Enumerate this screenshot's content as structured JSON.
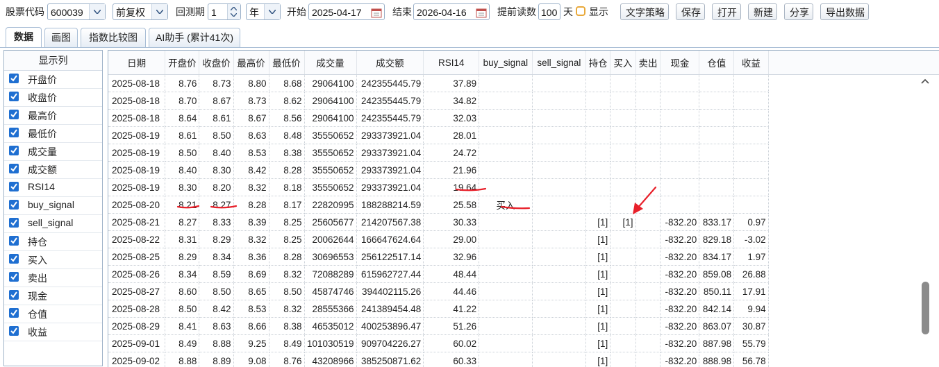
{
  "toolbar": {
    "stock_code_label": "股票代码",
    "stock_code_value": "600039",
    "adjust_value": "前复权",
    "backtest_label": "回测期",
    "backtest_value": "1",
    "period_unit": "年",
    "start_label": "开始",
    "start_value": "2025-04-17",
    "end_label": "结束",
    "end_value": "2026-04-16",
    "preload_label": "提前读数",
    "preload_value": "100",
    "preload_unit": "天",
    "show_label": "显示",
    "buttons": {
      "strategy": "文字策略",
      "save": "保存",
      "open": "打开",
      "new": "新建",
      "share": "分享",
      "export": "导出数据"
    }
  },
  "tabs": [
    "数据",
    "画图",
    "指数比较图",
    "AI助手 (累计41次)"
  ],
  "columns_panel": {
    "title": "显示列",
    "items": [
      "开盘价",
      "收盘价",
      "最高价",
      "最低价",
      "成交量",
      "成交额",
      "RSI14",
      "buy_signal",
      "sell_signal",
      "持仓",
      "买入",
      "卖出",
      "现金",
      "仓值",
      "收益"
    ]
  },
  "table": {
    "headers": [
      "日期",
      "开盘价",
      "收盘价",
      "最高价",
      "最低价",
      "成交量",
      "成交额",
      "RSI14",
      "buy_signal",
      "sell_signal",
      "持仓",
      "买入",
      "卖出",
      "现金",
      "仓值",
      "收益"
    ],
    "rows": [
      [
        "2025-08-18",
        "8.76",
        "8.73",
        "8.80",
        "8.68",
        "29064100",
        "242355445.79",
        "37.89",
        "",
        "",
        "",
        "",
        "",
        "",
        "",
        ""
      ],
      [
        "2025-08-18",
        "8.70",
        "8.67",
        "8.73",
        "8.62",
        "29064100",
        "242355445.79",
        "34.82",
        "",
        "",
        "",
        "",
        "",
        "",
        "",
        ""
      ],
      [
        "2025-08-18",
        "8.64",
        "8.61",
        "8.67",
        "8.56",
        "29064100",
        "242355445.79",
        "32.03",
        "",
        "",
        "",
        "",
        "",
        "",
        "",
        ""
      ],
      [
        "2025-08-19",
        "8.61",
        "8.50",
        "8.63",
        "8.48",
        "35550652",
        "293373921.04",
        "28.01",
        "",
        "",
        "",
        "",
        "",
        "",
        "",
        ""
      ],
      [
        "2025-08-19",
        "8.50",
        "8.40",
        "8.53",
        "8.38",
        "35550652",
        "293373921.04",
        "24.72",
        "",
        "",
        "",
        "",
        "",
        "",
        "",
        ""
      ],
      [
        "2025-08-19",
        "8.40",
        "8.30",
        "8.42",
        "8.28",
        "35550652",
        "293373921.04",
        "21.96",
        "",
        "",
        "",
        "",
        "",
        "",
        "",
        ""
      ],
      [
        "2025-08-19",
        "8.30",
        "8.20",
        "8.32",
        "8.18",
        "35550652",
        "293373921.04",
        "19.64",
        "",
        "",
        "",
        "",
        "",
        "",
        "",
        ""
      ],
      [
        "2025-08-20",
        "8.21",
        "8.27",
        "8.28",
        "8.17",
        "22820995",
        "188288214.59",
        "25.58",
        "买入",
        "",
        "",
        "",
        "",
        "",
        "",
        ""
      ],
      [
        "2025-08-21",
        "8.27",
        "8.33",
        "8.39",
        "8.25",
        "25605677",
        "214207567.38",
        "30.33",
        "",
        "",
        "[1]",
        "[1]",
        "",
        "-832.20",
        "833.17",
        "0.97"
      ],
      [
        "2025-08-22",
        "8.31",
        "8.29",
        "8.32",
        "8.25",
        "20062644",
        "166647624.64",
        "29.00",
        "",
        "",
        "[1]",
        "",
        "",
        "-832.20",
        "829.18",
        "-3.02"
      ],
      [
        "2025-08-25",
        "8.29",
        "8.34",
        "8.36",
        "8.28",
        "30696553",
        "256122517.14",
        "32.96",
        "",
        "",
        "[1]",
        "",
        "",
        "-832.20",
        "834.17",
        "1.97"
      ],
      [
        "2025-08-26",
        "8.34",
        "8.59",
        "8.69",
        "8.32",
        "72088289",
        "615962727.44",
        "48.44",
        "",
        "",
        "[1]",
        "",
        "",
        "-832.20",
        "859.08",
        "26.88"
      ],
      [
        "2025-08-27",
        "8.60",
        "8.50",
        "8.65",
        "8.50",
        "45874746",
        "394402115.26",
        "44.46",
        "",
        "",
        "[1]",
        "",
        "",
        "-832.20",
        "850.11",
        "17.91"
      ],
      [
        "2025-08-28",
        "8.50",
        "8.42",
        "8.53",
        "8.32",
        "28555366",
        "241389454.48",
        "41.22",
        "",
        "",
        "[1]",
        "",
        "",
        "-832.20",
        "842.14",
        "9.94"
      ],
      [
        "2025-08-29",
        "8.41",
        "8.63",
        "8.66",
        "8.38",
        "46535012",
        "400253896.47",
        "51.26",
        "",
        "",
        "[1]",
        "",
        "",
        "-832.20",
        "863.07",
        "30.87"
      ],
      [
        "2025-09-01",
        "8.49",
        "8.88",
        "9.25",
        "8.49",
        "101030519",
        "909704226.27",
        "60.02",
        "",
        "",
        "[1]",
        "",
        "",
        "-832.20",
        "887.98",
        "55.79"
      ],
      [
        "2025-09-02",
        "8.88",
        "8.89",
        "9.08",
        "8.76",
        "43208966",
        "385250871.62",
        "60.33",
        "",
        "",
        "[1]",
        "",
        "",
        "-832.20",
        "888.98",
        "56.78"
      ]
    ]
  },
  "colors": {
    "accent": "#1f6fd1",
    "annotation": "#e8202a",
    "checkbox_orange": "#e9a93b"
  }
}
